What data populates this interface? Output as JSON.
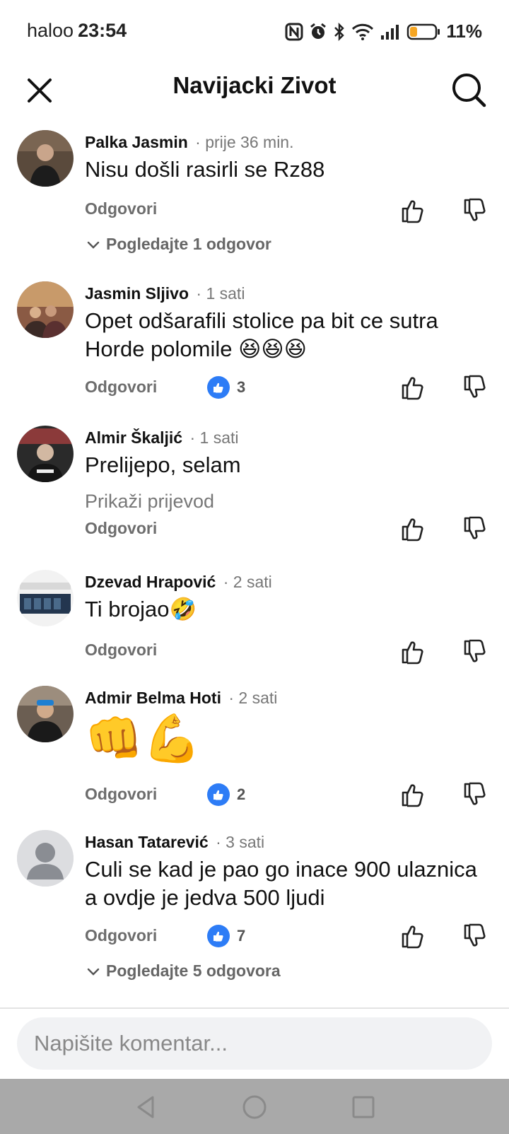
{
  "status_bar": {
    "carrier": "haloo",
    "time": "23:54",
    "battery": "11%",
    "icons": [
      "nfc-icon",
      "alarm-icon",
      "bluetooth-icon",
      "wifi-icon",
      "signal-icon",
      "battery-icon"
    ]
  },
  "header": {
    "title": "Navijacki Zivot",
    "close_icon": "close-icon",
    "search_icon": "search-icon"
  },
  "comments": [
    {
      "author": "Palka Jasmin",
      "time": "· prije 36 min.",
      "text": "Nisu došli rasirli se Rz88",
      "reply_label": "Odgovori",
      "more_replies": "Pogledajte 1 odgovor"
    },
    {
      "author": "Jasmin Sljivo",
      "time": "· 1 sati",
      "text": "Opet odšarafili stolice pa bit ce sutra Horde polomile 😆😆😆",
      "reply_label": "Odgovori",
      "likes": "3"
    },
    {
      "author": "Almir Škaljić",
      "time": "· 1 sati",
      "text": "Prelijepo, selam",
      "translate_label": "Prikaži prijevod",
      "reply_label": "Odgovori"
    },
    {
      "author": "Dzevad Hrapović",
      "time": "· 2 sati",
      "text": "Ti brojao🤣",
      "reply_label": "Odgovori"
    },
    {
      "author": "Admir Belma Hoti",
      "time": "· 2 sati",
      "text": "👊💪",
      "reply_label": "Odgovori",
      "likes": "2"
    },
    {
      "author": "Hasan Tatarević",
      "time": "· 3 sati",
      "text": "Culi se kad je pao go inace 900 ulaznica a ovdje je jedva 500 ljudi",
      "reply_label": "Odgovori",
      "likes": "7",
      "more_replies": "Pogledajte 5 odgovora"
    }
  ],
  "composer": {
    "placeholder": "Napišite komentar..."
  },
  "colors": {
    "like_blue": "#2d7cf6",
    "nav_bar": "#a9a9a9",
    "composer_bg": "#f1f2f4"
  }
}
